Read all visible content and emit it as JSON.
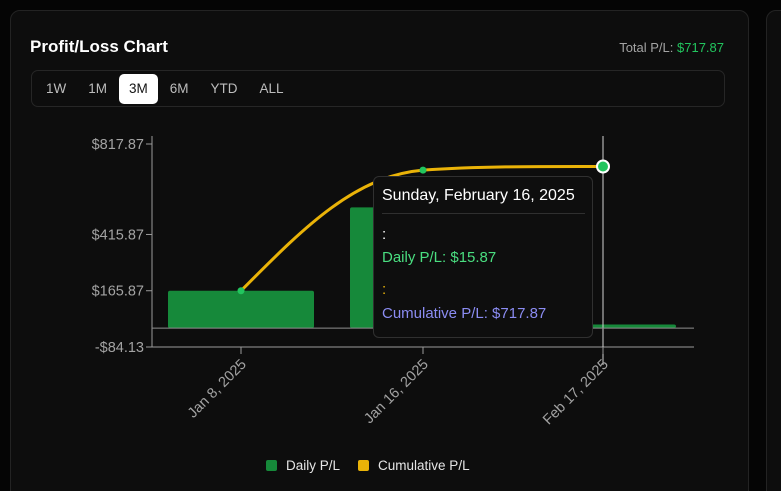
{
  "header": {
    "title": "Profit/Loss Chart",
    "total_label": "Total P/L: ",
    "total_value": "$717.87"
  },
  "range_tabs": [
    {
      "label": "1W",
      "active": false
    },
    {
      "label": "1M",
      "active": false
    },
    {
      "label": "3M",
      "active": true
    },
    {
      "label": "6M",
      "active": false
    },
    {
      "label": "YTD",
      "active": false
    },
    {
      "label": "ALL",
      "active": false
    }
  ],
  "tooltip": {
    "date": "Sunday, February 16, 2025",
    "colon_1": ":",
    "daily": "Daily P/L: $15.87",
    "colon_2": ":",
    "cumulative": "Cumulative P/L: $717.87"
  },
  "colors": {
    "daily": "#16893a",
    "cumulative": "#eab308",
    "positive": "#22c55e",
    "tooltip_cumulative": "#8b8cf2"
  },
  "chart_data": {
    "type": "bar",
    "title": "Profit/Loss Chart",
    "ylim": [
      -84.13,
      817.87
    ],
    "y_ticks": [
      "$817.87",
      "$415.87",
      "$165.87",
      "-$84.13"
    ],
    "x_ticks": [
      "Jan 8, 2025",
      "Jan 16, 2025",
      "Feb 17, 2025"
    ],
    "categories": [
      "Jan 8, 2025",
      "Jan 16, 2025",
      "Feb 16, 2025"
    ],
    "series": [
      {
        "name": "Daily P/L",
        "type": "bar",
        "values": [
          165.87,
          536,
          15.87
        ]
      },
      {
        "name": "Cumulative P/L",
        "type": "line",
        "values": [
          165.87,
          701.87,
          717.87
        ]
      }
    ],
    "legend": "bottom",
    "grid": false
  }
}
